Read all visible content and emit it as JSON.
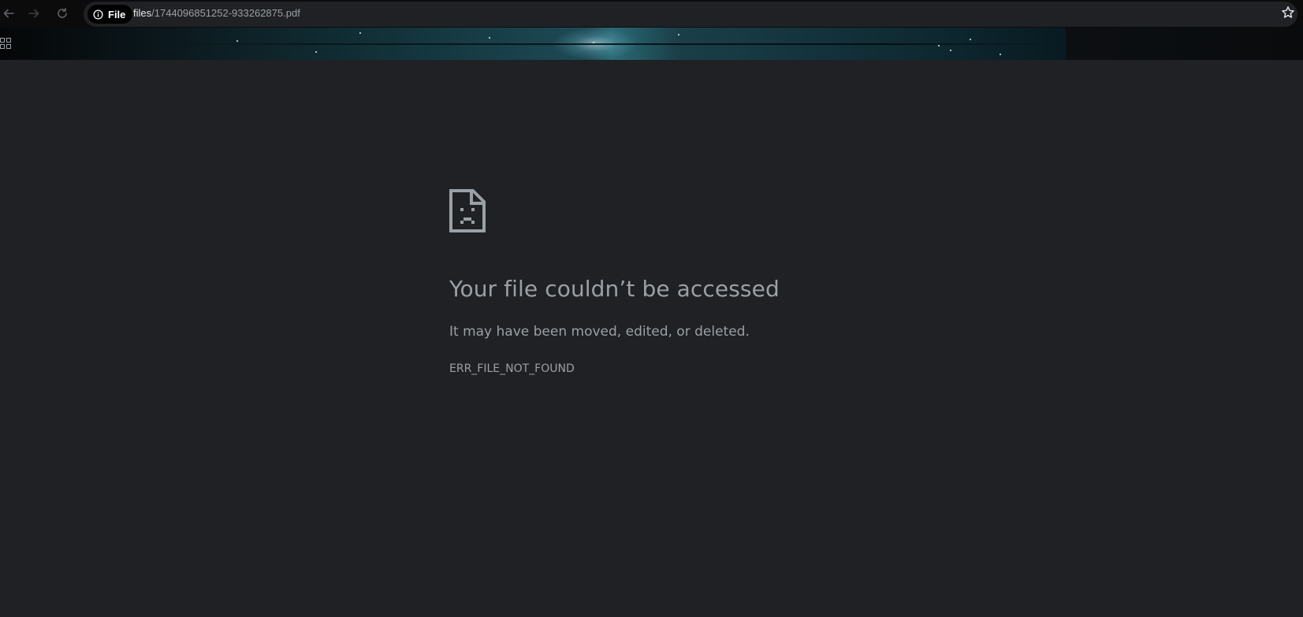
{
  "toolbar": {
    "back_icon": "arrow-left-icon",
    "forward_icon": "arrow-right-icon",
    "reload_icon": "reload-icon",
    "bookmark_icon": "star-outline-icon"
  },
  "omnibox": {
    "chip_label": "File",
    "chip_icon": "info-icon",
    "url_host": "files",
    "url_path": "/1744096851252-933262875.pdf"
  },
  "bookmarks_bar": {
    "apps_icon": "apps-grid-icon"
  },
  "error_page": {
    "icon": "sad-file-icon",
    "title": "Your file couldn’t be accessed",
    "message": "It may have been moved, edited, or deleted.",
    "code": "ERR_FILE_NOT_FOUND"
  },
  "colors": {
    "page_background": "#202124",
    "text_secondary": "#9aa0a6",
    "toolbar_background": "#0b0b0c"
  }
}
